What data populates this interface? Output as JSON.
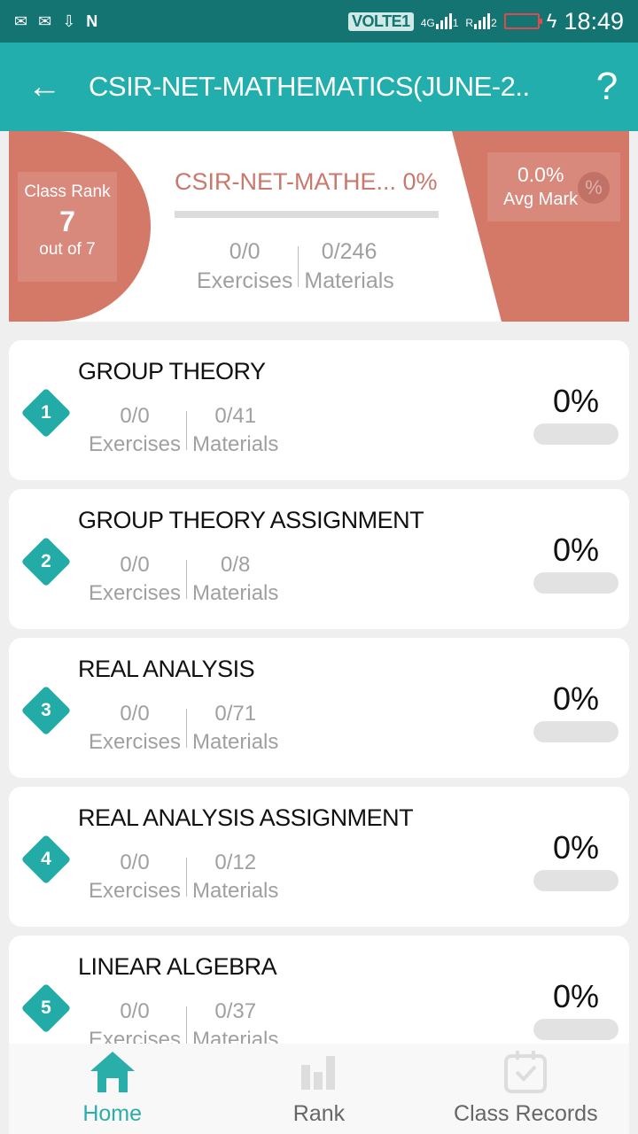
{
  "status_bar": {
    "left_icons": [
      "mail-icon",
      "mail-icon",
      "download-icon",
      "n-icon"
    ],
    "volte": "VOLTE1",
    "sim1_label": "4G",
    "sim1_index": "1",
    "sim2_label": "R",
    "sim2_index": "2",
    "time": "18:49"
  },
  "header": {
    "title": "CSIR-NET-MATHEMATICS(JUNE-2..",
    "back_icon": "←",
    "help_icon": "?"
  },
  "summary": {
    "class_rank_label": "Class Rank",
    "class_rank_value": "7",
    "class_rank_sub": "out of 7",
    "course_name": "CSIR-NET-MATHE... 0%",
    "course_progress": 0,
    "exercises_value": "0/0",
    "exercises_label": "Exercises",
    "materials_value": "0/246",
    "materials_label": "Materials",
    "avg_mark_value": "0.0%",
    "avg_mark_label": "Avg Mark",
    "avg_icon": "%"
  },
  "colors": {
    "primary": "#21aeac",
    "status_bar": "#147472",
    "accent": "#d47868"
  },
  "chapters": [
    {
      "index": "1",
      "title": "GROUP THEORY",
      "exercises": "0/0",
      "exercises_label": "Exercises",
      "materials": "0/41",
      "materials_label": "Materials",
      "percent": "0%",
      "progress": 0
    },
    {
      "index": "2",
      "title": "GROUP THEORY ASSIGNMENT",
      "exercises": "0/0",
      "exercises_label": "Exercises",
      "materials": "0/8",
      "materials_label": "Materials",
      "percent": "0%",
      "progress": 0
    },
    {
      "index": "3",
      "title": "REAL ANALYSIS",
      "exercises": "0/0",
      "exercises_label": "Exercises",
      "materials": "0/71",
      "materials_label": "Materials",
      "percent": "0%",
      "progress": 0
    },
    {
      "index": "4",
      "title": "REAL ANALYSIS ASSIGNMENT",
      "exercises": "0/0",
      "exercises_label": "Exercises",
      "materials": "0/12",
      "materials_label": "Materials",
      "percent": "0%",
      "progress": 0
    },
    {
      "index": "5",
      "title": "LINEAR ALGEBRA",
      "exercises": "0/0",
      "exercises_label": "Exercises",
      "materials": "0/37",
      "materials_label": "Materials",
      "percent": "0%",
      "progress": 0
    }
  ],
  "bottom_nav": [
    {
      "label": "Home",
      "icon": "home-icon",
      "active": true
    },
    {
      "label": "Rank",
      "icon": "bar-chart-icon",
      "active": false
    },
    {
      "label": "Class Records",
      "icon": "calendar-check-icon",
      "active": false
    }
  ]
}
